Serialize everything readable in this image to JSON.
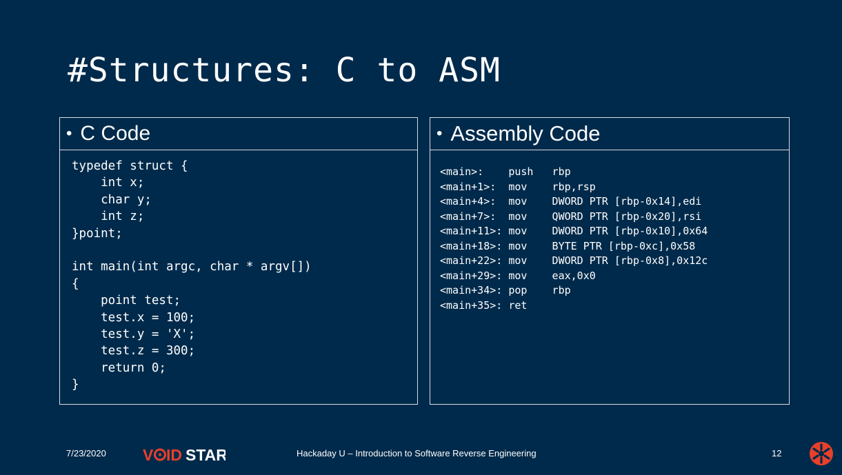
{
  "slide": {
    "title": "#Structures: C to ASM",
    "c_panel": {
      "bullet": "•",
      "header": "C Code",
      "code": "typedef struct {\n    int x;\n    char y;\n    int z;\n}point;\n\nint main(int argc, char * argv[])\n{\n    point test;\n    test.x = 100;\n    test.y = 'X';\n    test.z = 300;\n    return 0;\n}"
    },
    "asm_panel": {
      "bullet": "•",
      "header": "Assembly Code",
      "code": "<main>:    push   rbp\n<main+1>:  mov    rbp,rsp\n<main+4>:  mov    DWORD PTR [rbp-0x14],edi\n<main+7>:  mov    QWORD PTR [rbp-0x20],rsi\n<main+11>: mov    DWORD PTR [rbp-0x10],0x64\n<main+18>: mov    BYTE PTR [rbp-0xc],0x58\n<main+22>: mov    DWORD PTR [rbp-0x8],0x12c\n<main+29>: mov    eax,0x0\n<main+34>: pop    rbp\n<main+35>: ret"
    },
    "footer": {
      "date": "7/23/2020",
      "logo_text": "VOIDSTAR",
      "caption": "Hackaday U – Introduction to Software Reverse Engineering",
      "page_number": "12"
    },
    "colors": {
      "background": "#002a4b",
      "logo_red": "#e8402a",
      "logo_white": "#ffffff",
      "corner_icon": "#e8402a"
    },
    "icons": {
      "corner": "voidstar-star-icon"
    }
  }
}
